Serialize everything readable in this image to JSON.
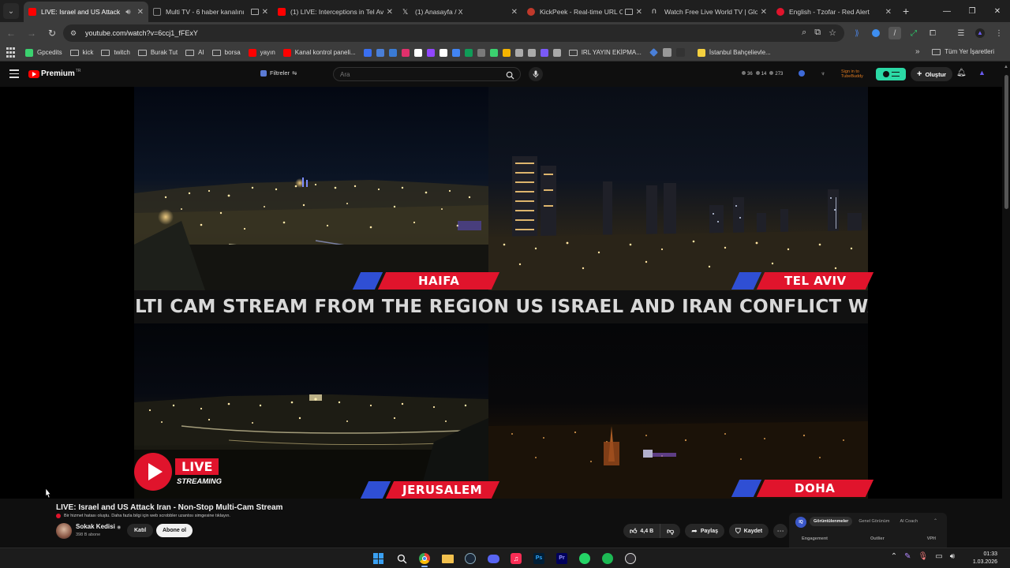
{
  "browser": {
    "tabs": [
      {
        "title": "LIVE: Israel and US Attack Iran - Non-Stop Multi-Cam Stream",
        "favicon_color": "#ff0000",
        "active": true
      },
      {
        "title": "Multi TV - 6 haber kanalını",
        "favicon_color": "#1f1f1f",
        "active": false
      },
      {
        "title": "(1) LIVE: Interceptions in Tel Aviv",
        "favicon_color": "#ff0000",
        "active": false
      },
      {
        "title": "(1) Anasayfa / X",
        "favicon_color": "#000000",
        "active": false
      },
      {
        "title": "KickPeek - Real-time URL C",
        "favicon_color": "#c0392b",
        "active": false
      },
      {
        "title": "Watch Free Live World TV | Glo",
        "favicon_color": "#1f1f1f",
        "active": false
      },
      {
        "title": "English - Tzofar - Red Alert",
        "favicon_color": "#e0142c",
        "active": false
      }
    ],
    "url": "youtube.com/watch?v=6ccj1_fFExY",
    "bookmarks": [
      {
        "label": "Gpcedits",
        "type": "site",
        "color": "#3bd16f"
      },
      {
        "label": "kick",
        "type": "folder"
      },
      {
        "label": "twitch",
        "type": "folder"
      },
      {
        "label": "Burak Tut",
        "type": "folder"
      },
      {
        "label": "AI",
        "type": "folder"
      },
      {
        "label": "borsa",
        "type": "folder"
      },
      {
        "label": "yayın",
        "type": "site",
        "color": "#ff0000"
      },
      {
        "label": "Kanal kontrol paneli...",
        "type": "site",
        "color": "#ff0000"
      }
    ],
    "bookmark_icons": [
      "#3a6ff0",
      "#4a7fd8",
      "#3a7bd5",
      "#e1306c",
      "#ffffff",
      "#9146ff",
      "#ffffff",
      "#4285f4",
      "#0f9d58",
      "#7a7a7a",
      "#3bd16f",
      "#f4b400",
      "#aaaaaa",
      "#aaaaaa",
      "#7a5af8",
      "#aaaaaa"
    ],
    "bookmarks_right": [
      {
        "label": "IRL YAYIN EKİPMA...",
        "type": "folder"
      },
      {
        "label": "İstanbul Bahçelievle...",
        "type": "site",
        "color": "#f4d03f"
      }
    ],
    "all_bookmarks": "Tüm Yer İşaretleri"
  },
  "youtube": {
    "brand": "Premium",
    "country": "TR",
    "filters": "Filtreler",
    "search_placeholder": "Ara",
    "stats": [
      "36",
      "14",
      "273"
    ],
    "tubebuddy": [
      "Sign in to",
      "TubeBuddy"
    ],
    "create": "Oluştur"
  },
  "video": {
    "cities": [
      "HAIFA",
      "TEL AVIV",
      "JERUSALEM",
      "DOHA"
    ],
    "ticker": "ULTI CAM STREAM FROM THE REGION US ISRAEL AND IRAN CONFLICT WATCH LI",
    "live": "LIVE",
    "streaming": "STREAMING",
    "title": "LIVE: Israel and US Attack Iran - Non-Stop Multi-Cam Stream",
    "notice": "Bir hizmet hatası oluştu. Daha fazla bilgi için web scrobbler uzantısı simgesine tıklayın.",
    "channel": "Sokak Kedisi",
    "subscribers": "398 B abone",
    "join": "Katıl",
    "subscribe": "Abone ol",
    "likes": "4,4 B",
    "share": "Paylaş",
    "save": "Kaydet"
  },
  "vidiq": {
    "logo": "IQ",
    "tabs": [
      "Görüntülenmeler",
      "Genel Görünüm",
      "AI Coach"
    ],
    "columns": [
      "Engagement",
      "Outlier",
      "VPH"
    ]
  },
  "taskbar": {
    "time": "01:33",
    "date": "1.03.2026"
  }
}
